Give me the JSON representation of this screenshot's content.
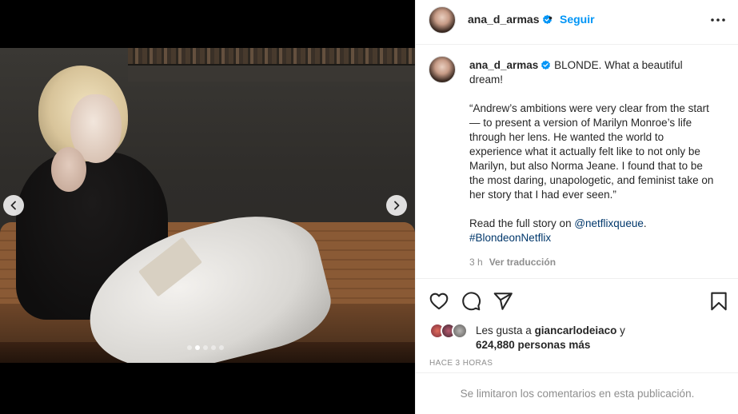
{
  "post": {
    "carousel": {
      "total_slides": 5,
      "active_index": 1
    },
    "author": {
      "username": "ana_d_armas",
      "verified": true
    },
    "header": {
      "separator": "•",
      "follow_label": "Seguir"
    },
    "caption": {
      "username": "ana_d_armas",
      "line1": "BLONDE. What a beautiful dream!",
      "quote": "“Andrew’s ambitions were very clear from the start — to present a version of Marilyn Monroe’s life through her lens. He wanted the world to experience what it actually felt like to not only be Marilyn, but also Norma Jeane. I found that to be the most daring, unapologetic, and feminist take on her story that I had ever seen.”",
      "read_more_prefix": "Read the full story on ",
      "mention": "@netflixqueue",
      "read_more_suffix": ".",
      "hashtag": "#BlondeonNetflix",
      "age": "3 h",
      "translate_label": "Ver traducción"
    },
    "likes": {
      "prefix": "Les gusta a ",
      "liker": "giancarlodeiaco",
      "conjunction": " y",
      "others": "624,880 personas más"
    },
    "timestamp": "HACE 3 HORAS",
    "comments_notice": "Se limitaron los comentarios en esta publicación."
  },
  "icons": {
    "prev": "chevron-left-icon",
    "next": "chevron-right-icon",
    "more": "more-horizontal-icon",
    "like": "heart-icon",
    "comment": "comment-icon",
    "share": "send-icon",
    "save": "bookmark-icon",
    "verified": "verified-badge-icon"
  },
  "colors": {
    "accent": "#0095f6",
    "link": "#00376b",
    "muted": "#8e8e8e",
    "text": "#262626",
    "verified": "#0095f6"
  }
}
